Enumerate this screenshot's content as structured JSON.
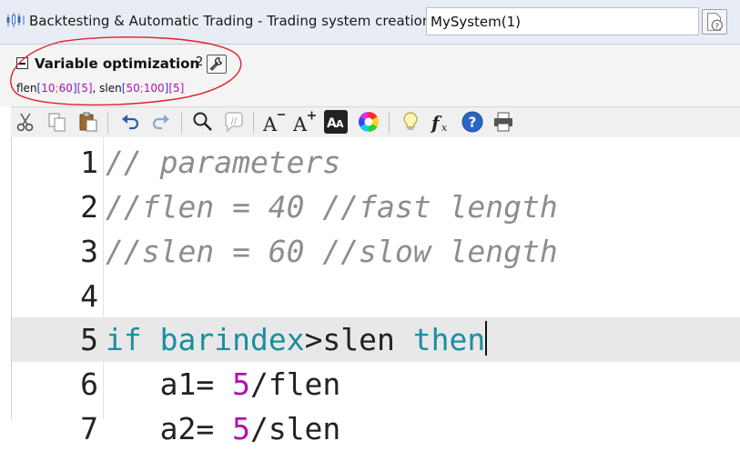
{
  "window": {
    "title": "Backtesting & Automatic Trading - Trading system creation",
    "system_name": "MySystem(1)"
  },
  "optimization": {
    "title": "Variable optimization",
    "count": "2",
    "params": [
      {
        "name": "flen",
        "open": "[",
        "min": "10",
        "sep": ";",
        "max": "60",
        "close": "]",
        "step": "[5]"
      },
      {
        "name": "slen",
        "open": "[",
        "min": "50",
        "sep": ";",
        "max": "100",
        "close": "]",
        "step": "[5]"
      }
    ],
    "param_separator": ", "
  },
  "toolbar": {
    "icons": [
      "cut-icon",
      "copy-icon",
      "paste-icon",
      "undo-icon",
      "redo-icon",
      "search-icon",
      "comment-icon",
      "decrease-font-icon",
      "increase-font-icon",
      "font-style-icon",
      "color-wheel-icon",
      "lightbulb-icon",
      "function-icon",
      "help-icon",
      "print-icon"
    ]
  },
  "editor": {
    "lines": [
      {
        "num": "1",
        "text": "// parameters"
      },
      {
        "num": "2",
        "text": "//flen = 40 //fast length"
      },
      {
        "num": "3",
        "text": "//slen = 60 //slow length"
      },
      {
        "num": "4",
        "text": ""
      },
      {
        "num": "5",
        "kw1": "if",
        "mid1": " barindex",
        "mid2": ">slen ",
        "kw2": "then"
      },
      {
        "num": "6",
        "pre": "   a1= ",
        "numval": "5",
        "post": "/flen"
      },
      {
        "num": "7",
        "pre": "   a2= ",
        "numval": "5",
        "post": "/slen"
      }
    ]
  },
  "colors": {
    "comment": "#8d8d8d",
    "keyword": "#1a8fa0",
    "number": "#b010b0",
    "annotation": "#e0202a"
  }
}
